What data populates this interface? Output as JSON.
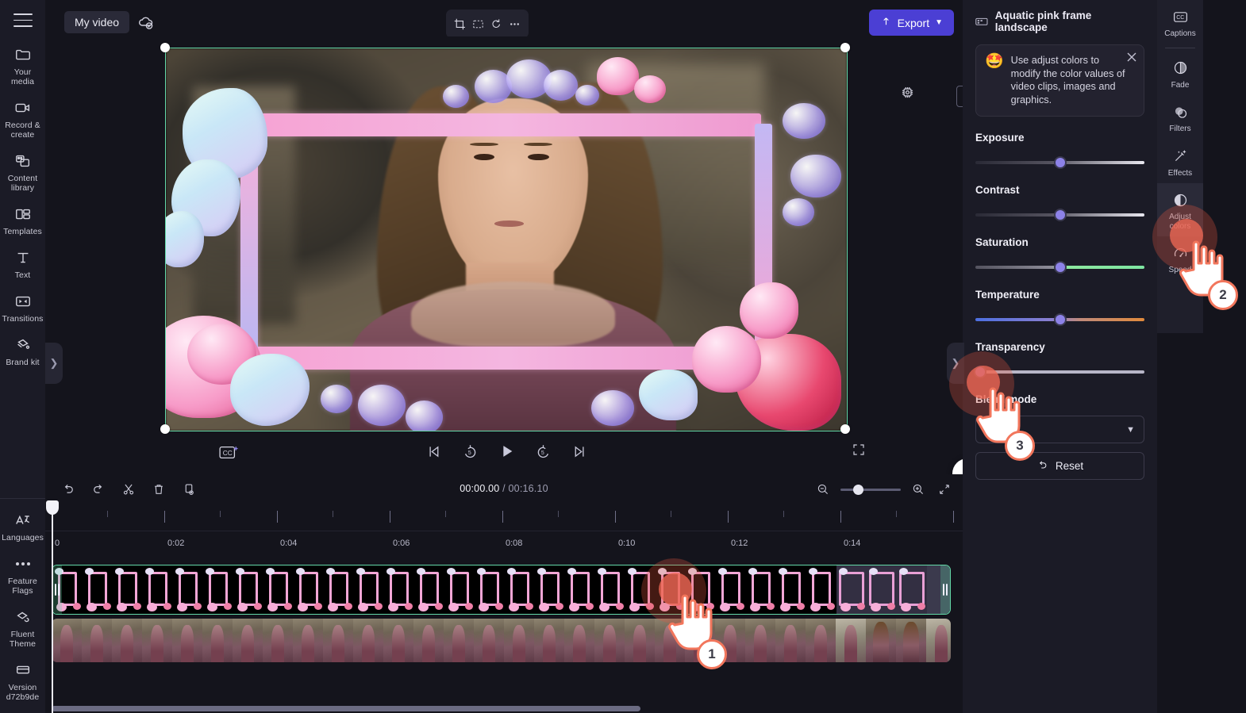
{
  "app": {
    "left_rail": {
      "menu_icon": "hamburger-icon",
      "items": [
        {
          "label": "Your media",
          "icon": "folder-icon"
        },
        {
          "label": "Record & create",
          "icon": "video-camera-icon"
        },
        {
          "label": "Content library",
          "icon": "library-icon"
        },
        {
          "label": "Templates",
          "icon": "templates-icon"
        },
        {
          "label": "Text",
          "icon": "text-icon"
        },
        {
          "label": "Transitions",
          "icon": "transitions-icon"
        },
        {
          "label": "Brand kit",
          "icon": "brand-kit-icon"
        }
      ],
      "bottom_items": [
        {
          "label": "Languages",
          "icon": "translate-icon"
        },
        {
          "label": "Feature Flags",
          "icon": "ellipsis-icon"
        },
        {
          "label": "Fluent Theme",
          "icon": "theme-icon"
        },
        {
          "label": "Version d72b9de",
          "icon": "archive-icon"
        }
      ],
      "expand_chevron": "chevron-right-icon"
    },
    "topbar": {
      "project_name": "My video",
      "cloud_status_icon": "cloud-saved-icon",
      "tools": [
        {
          "name": "crop-tool",
          "icon": "crop-icon"
        },
        {
          "name": "fit-tool",
          "icon": "fit-icon"
        },
        {
          "name": "rotate-tool",
          "icon": "rotate-icon"
        },
        {
          "name": "more-tool",
          "icon": "ellipsis-icon"
        }
      ],
      "export_label": "Export",
      "export_icon": "upload-icon",
      "export_chevron": "chevron-down-icon",
      "export_color": "#4b3fd4"
    },
    "preview": {
      "aspect_ratio": "16:9",
      "gear_icon": "settings-chip-icon",
      "captions_icon": "cc-plus-icon",
      "fullscreen_icon": "fullscreen-icon",
      "help_label": "?",
      "collapse_icon": "chevron-down-icon",
      "selection_color": "#63d9a8",
      "transport": [
        {
          "name": "skip-to-start-button",
          "icon": "skip-start-icon"
        },
        {
          "name": "rewind-5-button",
          "icon": "rewind-5-icon"
        },
        {
          "name": "play-button",
          "icon": "play-icon"
        },
        {
          "name": "forward-5-button",
          "icon": "forward-5-icon"
        },
        {
          "name": "skip-to-end-button",
          "icon": "skip-end-icon"
        }
      ]
    },
    "timeline": {
      "tools": [
        {
          "name": "undo-button",
          "icon": "undo-icon"
        },
        {
          "name": "redo-button",
          "icon": "redo-icon"
        },
        {
          "name": "split-button",
          "icon": "scissors-icon"
        },
        {
          "name": "delete-button",
          "icon": "trash-icon"
        },
        {
          "name": "duplicate-button",
          "icon": "duplicate-icon"
        }
      ],
      "current_time": "00:00.00",
      "total_time": "00:16.10",
      "time_separator": "/",
      "zoom_out_icon": "zoom-out-icon",
      "zoom_in_icon": "zoom-in-icon",
      "fit_icon": "fit-timeline-icon",
      "ruler_labels": [
        "0",
        "0:02",
        "0:04",
        "0:06",
        "0:08",
        "0:10",
        "0:12",
        "0:14"
      ],
      "tracks": [
        {
          "name": "graphic-clip",
          "selected": true
        },
        {
          "name": "video-clip",
          "selected": false
        }
      ]
    },
    "right_panel": {
      "clip_title": "Aquatic pink frame landscape",
      "clip_icon": "film-strip-icon",
      "tip": {
        "emoji": "🤩",
        "text": "Use adjust colors to modify the color values of video clips, images and graphics.",
        "close_icon": "close-icon"
      },
      "sliders": [
        {
          "label": "Exposure",
          "value_pct": 50,
          "track": "gray"
        },
        {
          "label": "Contrast",
          "value_pct": 50,
          "track": "gray"
        },
        {
          "label": "Saturation",
          "value_pct": 50,
          "track": "green"
        },
        {
          "label": "Temperature",
          "value_pct": 50,
          "track": "temp"
        },
        {
          "label": "Transparency",
          "value_pct": 0,
          "track": "flat"
        }
      ],
      "blend_mode_label": "Blend mode",
      "blend_mode_value": "Normal",
      "blend_mode_chevron": "chevron-down-icon",
      "reset_label": "Reset",
      "reset_icon": "undo-icon",
      "collapse_chevron": "chevron-right-icon"
    },
    "far_rail": {
      "tabs": [
        {
          "label": "Captions",
          "icon": "cc-icon",
          "active": false
        },
        {
          "label": "Fade",
          "icon": "fade-icon",
          "active": false
        },
        {
          "label": "Filters",
          "icon": "filters-icon",
          "active": false
        },
        {
          "label": "Effects",
          "icon": "effects-wand-icon",
          "active": false
        },
        {
          "label": "Adjust colors",
          "icon": "adjust-colors-icon",
          "active": true
        },
        {
          "label": "Speed",
          "icon": "speed-icon",
          "active": false
        }
      ]
    },
    "annotations": {
      "accent_color": "#f2765c",
      "steps": [
        {
          "number": "1",
          "target": "timeline-graphic-clip"
        },
        {
          "number": "2",
          "target": "adjust-colors-tab"
        },
        {
          "number": "3",
          "target": "transparency-slider"
        }
      ]
    }
  }
}
